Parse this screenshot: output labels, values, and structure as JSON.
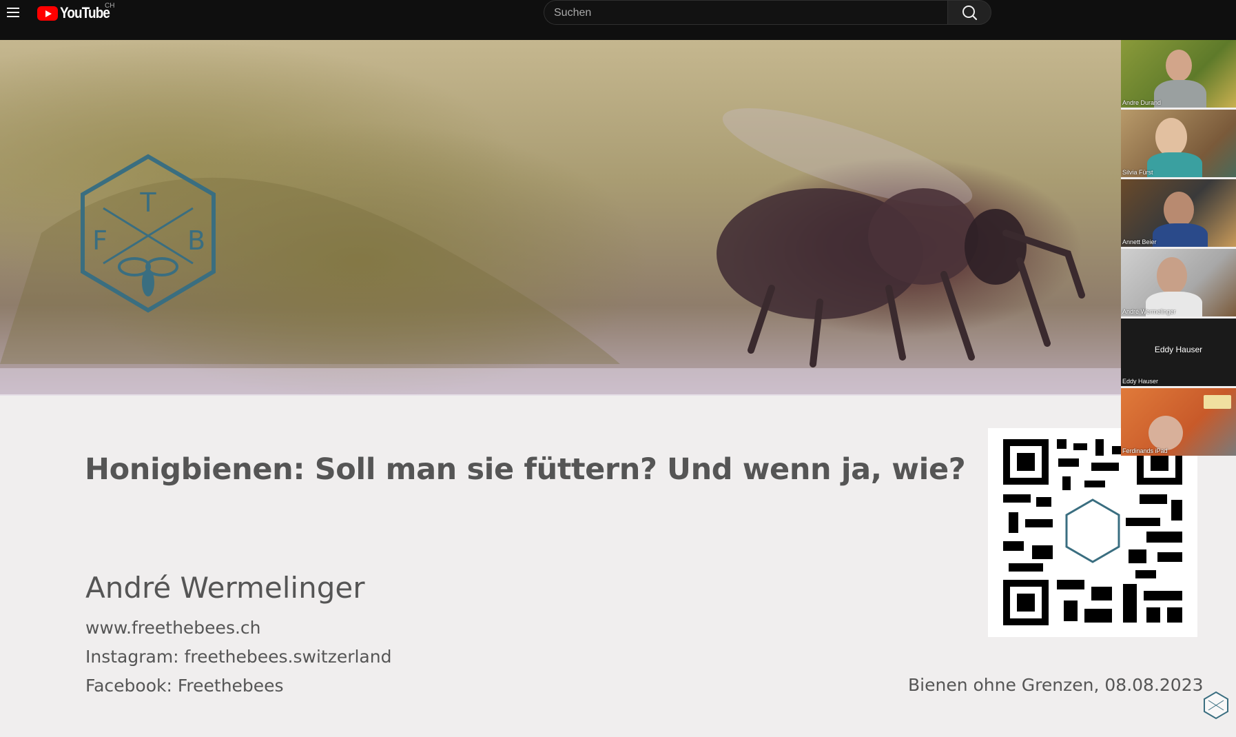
{
  "header": {
    "brand": "YouTube",
    "country_code": "CH",
    "search_placeholder": "Suchen"
  },
  "slide": {
    "logo_letters": [
      "T",
      "F",
      "B"
    ],
    "title": "Honigbienen: Soll man sie füttern? Und wenn ja, wie?",
    "presenter": "André Wermelinger",
    "website": "www.freethebees.ch",
    "instagram": "Instagram: freethebees.switzerland",
    "facebook": "Facebook: Freethebees",
    "event": "Bienen ohne Grenzen, 08.08.2023"
  },
  "participants": [
    {
      "name": "Andre Durand"
    },
    {
      "name": "Silvia Fürst"
    },
    {
      "name": "Annett Beier"
    },
    {
      "name": "André Wermelinger"
    },
    {
      "name": "Eddy Hauser",
      "display_label": "Eddy Hauser"
    },
    {
      "name": "Ferdinands iPad"
    }
  ],
  "colors": {
    "brand_red": "#ff0000",
    "logo_teal": "#3a6e80",
    "slide_text": "#555555"
  }
}
